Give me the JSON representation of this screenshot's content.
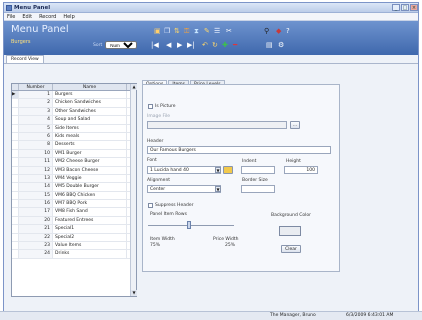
{
  "window": {
    "title": "Menu Panel"
  },
  "menu": [
    "File",
    "Edit",
    "Record",
    "Help"
  ],
  "header": {
    "title": "Menu Panel",
    "subtitle": "Burgers",
    "sort_label": "Sort",
    "sort_value": "Number"
  },
  "view_tabs": [
    "Record View"
  ],
  "grid": {
    "columns": [
      "Number",
      "Name"
    ],
    "rows": [
      {
        "number": "1",
        "name": "Burgers"
      },
      {
        "number": "2",
        "name": "Chicken Sandwiches"
      },
      {
        "number": "3",
        "name": "Other Sandwiches"
      },
      {
        "number": "4",
        "name": "Soup and Salad"
      },
      {
        "number": "5",
        "name": "Side Items"
      },
      {
        "number": "6",
        "name": "Kids meals"
      },
      {
        "number": "8",
        "name": "Desserts"
      },
      {
        "number": "10",
        "name": "VM1 Burger"
      },
      {
        "number": "11",
        "name": "VM2 Cheese Burger"
      },
      {
        "number": "12",
        "name": "VM3 Bacon Cheese"
      },
      {
        "number": "13",
        "name": "VM4 Veggie"
      },
      {
        "number": "14",
        "name": "VM5 Double Burger"
      },
      {
        "number": "15",
        "name": "VM6 BBQ Chicken"
      },
      {
        "number": "16",
        "name": "VM7 BBQ Pork"
      },
      {
        "number": "17",
        "name": "VM8 Fish Sand"
      },
      {
        "number": "20",
        "name": "Featured Entrees"
      },
      {
        "number": "21",
        "name": "Special1"
      },
      {
        "number": "22",
        "name": "Special2"
      },
      {
        "number": "23",
        "name": "Value Items"
      },
      {
        "number": "24",
        "name": "Drinks"
      }
    ]
  },
  "panel": {
    "tabs": [
      "Options",
      "Items",
      "Price Levels"
    ],
    "is_picture": "Is Picture",
    "image_file": "Image File",
    "header_label": "Header",
    "header_value": "Our Famous Burgers",
    "font_label": "Font",
    "font_value": "1 Lucida hand 40",
    "indent_label": "Indent",
    "height_label": "Height",
    "height_value": "100",
    "alignment_label": "Alignment",
    "alignment_value": "Center",
    "border_size_label": "Border Size",
    "suppress_header": "Suppress Header",
    "panel_item_rows": "Panel Item Rows",
    "item_width_label": "Item Width",
    "item_width_value": "75%",
    "price_width_label": "Price Width",
    "price_width_value": "25%",
    "bg_color_label": "Background Color",
    "clear_label": "Clear",
    "browse_label": "..."
  },
  "status": {
    "user": "The Manager, Bruno",
    "datetime": "6/3/2009 6:43:01 AM"
  }
}
